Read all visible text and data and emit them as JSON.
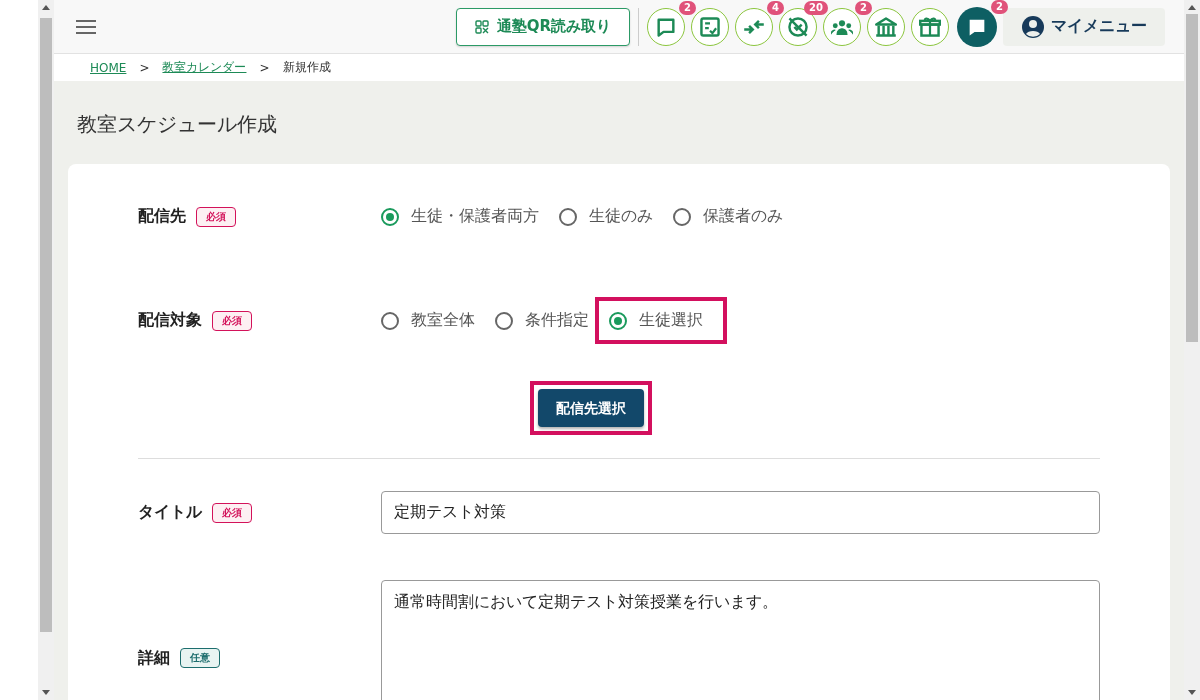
{
  "header": {
    "qr_button": "通塾QR読み取り",
    "icon_buttons": [
      {
        "kind": "chat",
        "badge": "2"
      },
      {
        "kind": "checklist"
      },
      {
        "kind": "arrows",
        "badge": "4"
      },
      {
        "kind": "crossed",
        "badge": "20"
      },
      {
        "kind": "people",
        "badge": "2"
      },
      {
        "kind": "building"
      },
      {
        "kind": "gift"
      },
      {
        "kind": "message",
        "badge": "2"
      }
    ],
    "my_menu": "マイメニュー"
  },
  "breadcrumb": {
    "items": [
      {
        "label": "HOME",
        "link": true
      },
      {
        "label": "教室カレンダー",
        "link": true
      },
      {
        "label": "新規作成",
        "link": false
      }
    ],
    "separators": [
      ">",
      ">"
    ]
  },
  "page_title": "教室スケジュール作成",
  "form": {
    "fields": [
      {
        "kind": "radio",
        "label": "配信先",
        "requirement": {
          "text": "必須",
          "required": true
        },
        "options": [
          {
            "label": "生徒・保護者両方",
            "selected": true,
            "highlighted": false
          },
          {
            "label": "生徒のみ",
            "selected": false,
            "highlighted": false
          },
          {
            "label": "保護者のみ",
            "selected": false,
            "highlighted": false
          }
        ]
      },
      {
        "kind": "radio",
        "label": "配信対象",
        "requirement": {
          "text": "必須",
          "required": true
        },
        "options": [
          {
            "label": "教室全体",
            "selected": false,
            "highlighted": false
          },
          {
            "label": "条件指定",
            "selected": false,
            "highlighted": false
          },
          {
            "label": "生徒選択",
            "selected": true,
            "highlighted": true
          }
        ],
        "button": {
          "label": "配信先選択",
          "highlighted": true
        },
        "divider_after": true
      },
      {
        "kind": "text",
        "label": "タイトル",
        "requirement": {
          "text": "必須",
          "required": true
        },
        "value": "定期テスト対策"
      },
      {
        "kind": "textarea",
        "label": "詳細",
        "requirement": {
          "text": "任意",
          "required": false
        },
        "value": "通常時間割において定期テスト対策授業を行います。"
      }
    ]
  }
}
